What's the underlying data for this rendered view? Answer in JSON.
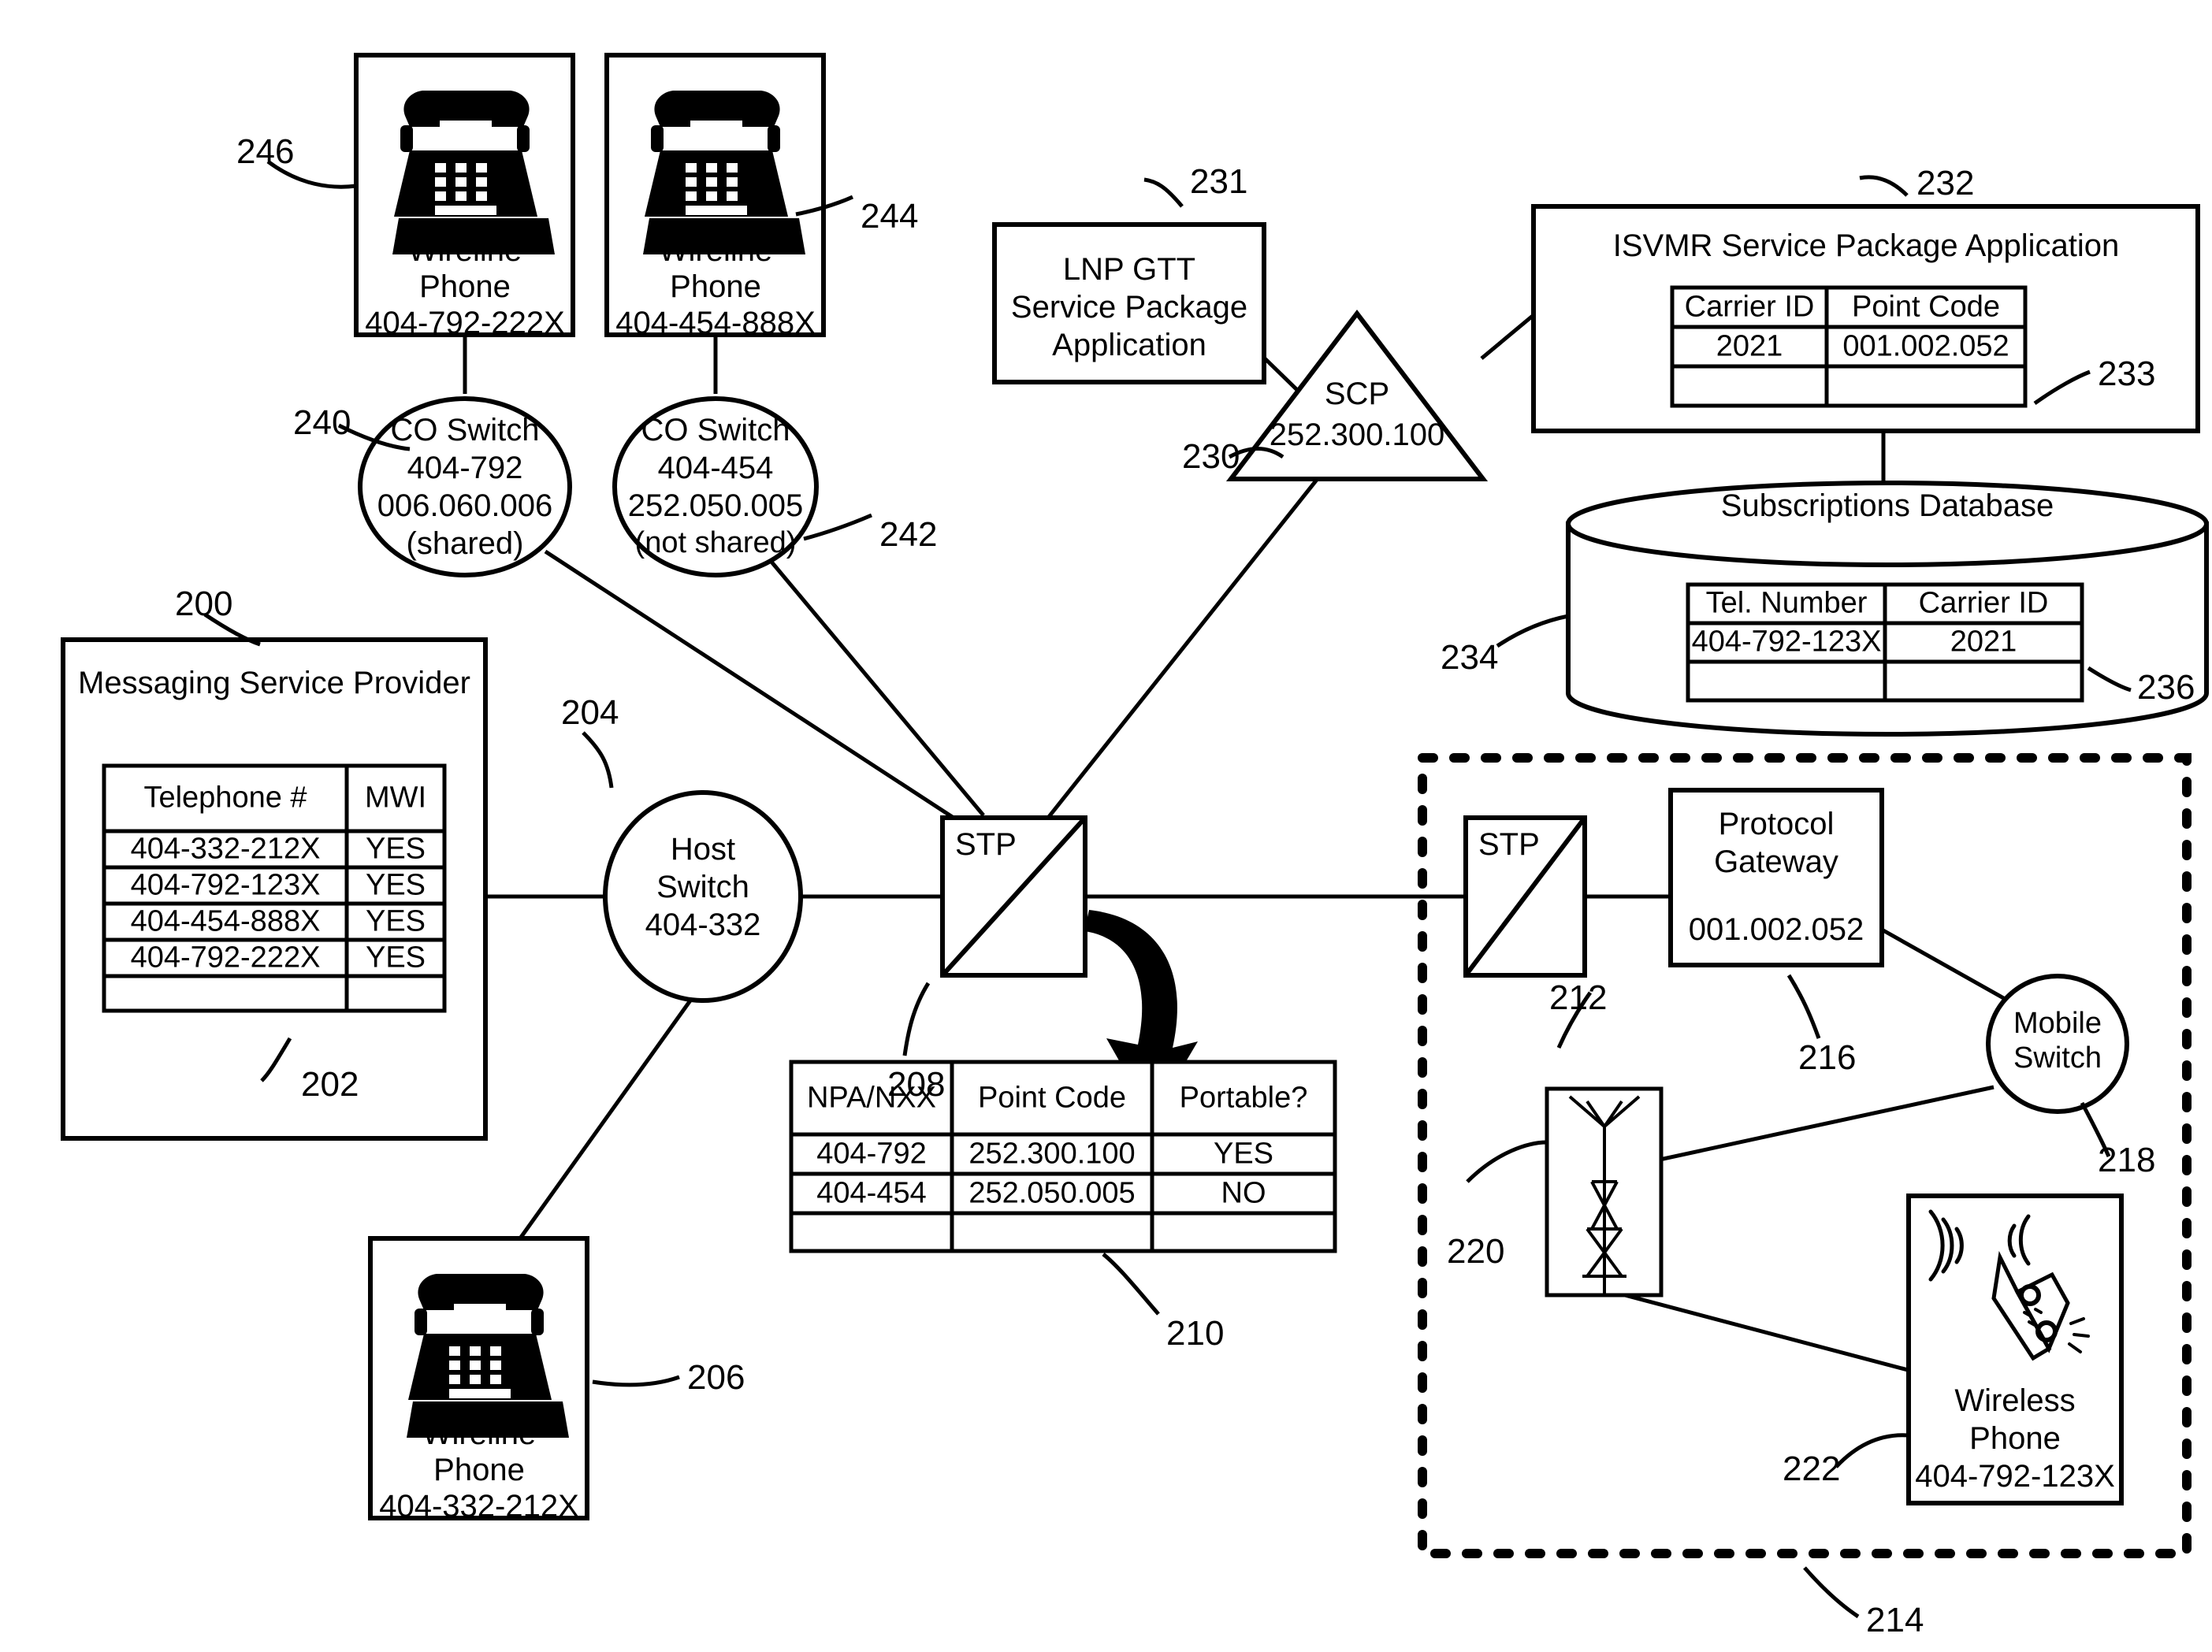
{
  "figure": {
    "domain": "patent-network-diagram",
    "background": "#ffffff",
    "stroke": "#000000"
  },
  "nodes": {
    "wireline_phone_246": {
      "ref": "246",
      "line1": "Wireline",
      "line2": "Phone",
      "number": "404-792-222X",
      "icon": "desk-phone-icon"
    },
    "wireline_phone_244": {
      "ref": "244",
      "line1": "Wireline",
      "line2": "Phone",
      "number": "404-454-888X",
      "icon": "desk-phone-icon"
    },
    "wireline_phone_206": {
      "ref": "206",
      "line1": "Wireline",
      "line2": "Phone",
      "number": "404-332-212X",
      "icon": "desk-phone-icon"
    },
    "wireless_phone_222": {
      "ref": "222",
      "line1": "Wireless",
      "line2": "Phone",
      "number": "404-792-123X",
      "icon": "mobile-phone-icon"
    },
    "co_switch_240": {
      "ref": "240",
      "line1": "CO Switch",
      "line2": "404-792",
      "line3": "006.060.006",
      "line4": "(shared)"
    },
    "co_switch_242": {
      "ref": "242",
      "line1": "CO Switch",
      "line2": "404-454",
      "line3": "252.050.005",
      "line4": "(not shared)"
    },
    "host_switch_204": {
      "ref": "204",
      "line1": "Host",
      "line2": "Switch",
      "line3": "404-332"
    },
    "mobile_switch_218": {
      "ref": "218",
      "line1": "Mobile",
      "line2": "Switch"
    },
    "stp_208": {
      "ref": "208",
      "label": "STP"
    },
    "stp_212": {
      "ref": "212",
      "label": "STP"
    },
    "scp_230": {
      "ref": "230",
      "line1": "SCP",
      "line2": "252.300.100"
    },
    "lnp_gtt_231": {
      "ref": "231",
      "line1": "LNP GTT",
      "line2": "Service Package",
      "line3": "Application"
    },
    "isvmr_232": {
      "ref": "232",
      "title": "ISVMR Service Package Application"
    },
    "subscriptions_db_234": {
      "ref": "234",
      "title": "Subscriptions Database"
    },
    "messaging_provider_200": {
      "ref": "200",
      "title": "Messaging Service Provider"
    },
    "protocol_gateway_216": {
      "ref": "216",
      "line1": "Protocol",
      "line2": "Gateway",
      "line3": "001.002.052"
    },
    "cell_tower_220": {
      "ref": "220",
      "icon": "cell-tower-icon"
    },
    "wireless_network_214": {
      "ref": "214",
      "label": ""
    }
  },
  "tables": {
    "mwi_table_202": {
      "ref": "202",
      "headers": [
        "Telephone #",
        "MWI"
      ],
      "rows": [
        [
          "404-332-212X",
          "YES"
        ],
        [
          "404-792-123X",
          "YES"
        ],
        [
          "404-454-888X",
          "YES"
        ],
        [
          "404-792-222X",
          "YES"
        ],
        [
          "",
          ""
        ]
      ]
    },
    "npa_nxx_table_210": {
      "ref": "210",
      "headers": [
        "NPA/NXX",
        "Point Code",
        "Portable?"
      ],
      "rows": [
        [
          "404-792",
          "252.300.100",
          "YES"
        ],
        [
          "404-454",
          "252.050.005",
          "NO"
        ],
        [
          "",
          "",
          ""
        ]
      ]
    },
    "carrier_table_233": {
      "ref": "233",
      "headers": [
        "Carrier ID",
        "Point Code"
      ],
      "rows": [
        [
          "2021",
          "001.002.052"
        ],
        [
          "",
          ""
        ]
      ]
    },
    "subscriptions_table_236": {
      "ref": "236",
      "headers": [
        "Tel. Number",
        "Carrier ID"
      ],
      "rows": [
        [
          "404-792-123X",
          "2021"
        ],
        [
          "",
          ""
        ]
      ]
    }
  }
}
